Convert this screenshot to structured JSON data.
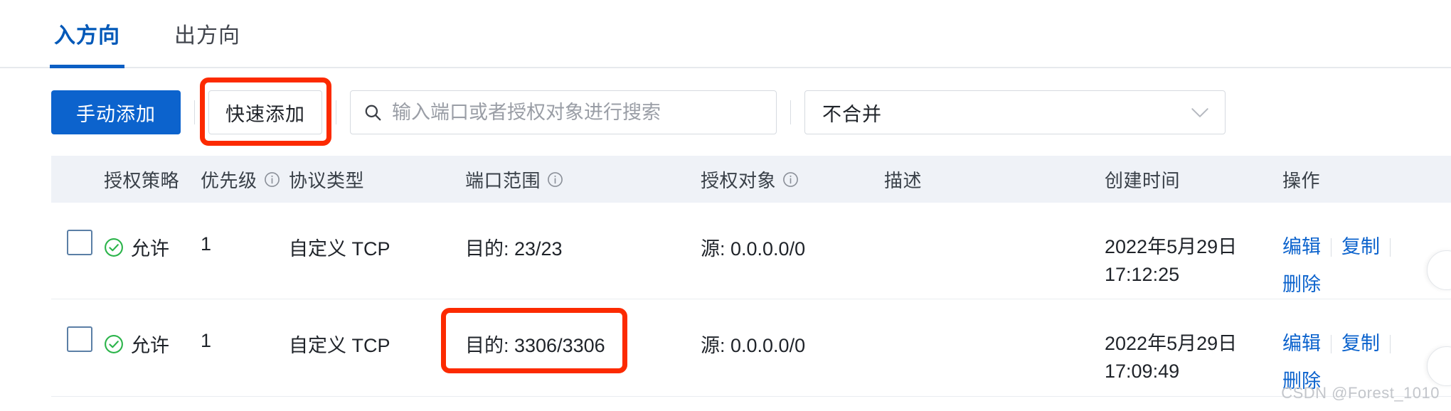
{
  "tabs": [
    {
      "label": "入方向",
      "active": true
    },
    {
      "label": "出方向",
      "active": false
    }
  ],
  "toolbar": {
    "manual_add_label": "手动添加",
    "quick_add_label": "快速添加",
    "search_placeholder": "输入端口或者授权对象进行搜索",
    "search_value": "",
    "merge_select_value": "不合并",
    "merge_select_options": [
      "不合并"
    ]
  },
  "table": {
    "columns": [
      {
        "key": "policy",
        "label": "授权策略",
        "info": false
      },
      {
        "key": "priority",
        "label": "优先级",
        "info": true
      },
      {
        "key": "protocol",
        "label": "协议类型",
        "info": false
      },
      {
        "key": "port",
        "label": "端口范围",
        "info": true
      },
      {
        "key": "target",
        "label": "授权对象",
        "info": true
      },
      {
        "key": "description",
        "label": "描述",
        "info": false
      },
      {
        "key": "created",
        "label": "创建时间",
        "info": false
      },
      {
        "key": "action",
        "label": "操作",
        "info": false
      }
    ],
    "rows": [
      {
        "policy": "允许",
        "priority": "1",
        "protocol": "自定义 TCP",
        "port": "目的: 23/23",
        "target": "源: 0.0.0.0/0",
        "description": "",
        "created_date": "2022年5月29日",
        "created_time": "17:12:25",
        "actions": [
          "编辑",
          "复制",
          "删除"
        ],
        "port_highlighted": false
      },
      {
        "policy": "允许",
        "priority": "1",
        "protocol": "自定义 TCP",
        "port": "目的: 3306/3306",
        "target": "源: 0.0.0.0/0",
        "description": "",
        "created_date": "2022年5月29日",
        "created_time": "17:09:49",
        "actions": [
          "编辑",
          "复制",
          "删除"
        ],
        "port_highlighted": true
      }
    ]
  },
  "colors": {
    "primary": "#0c63cd",
    "tab_active": "#0058b8",
    "highlight": "#fc2a00",
    "allow_green": "#2bb44a",
    "header_bg": "#eff2f7"
  },
  "watermark": "CSDN @Forest_1010"
}
